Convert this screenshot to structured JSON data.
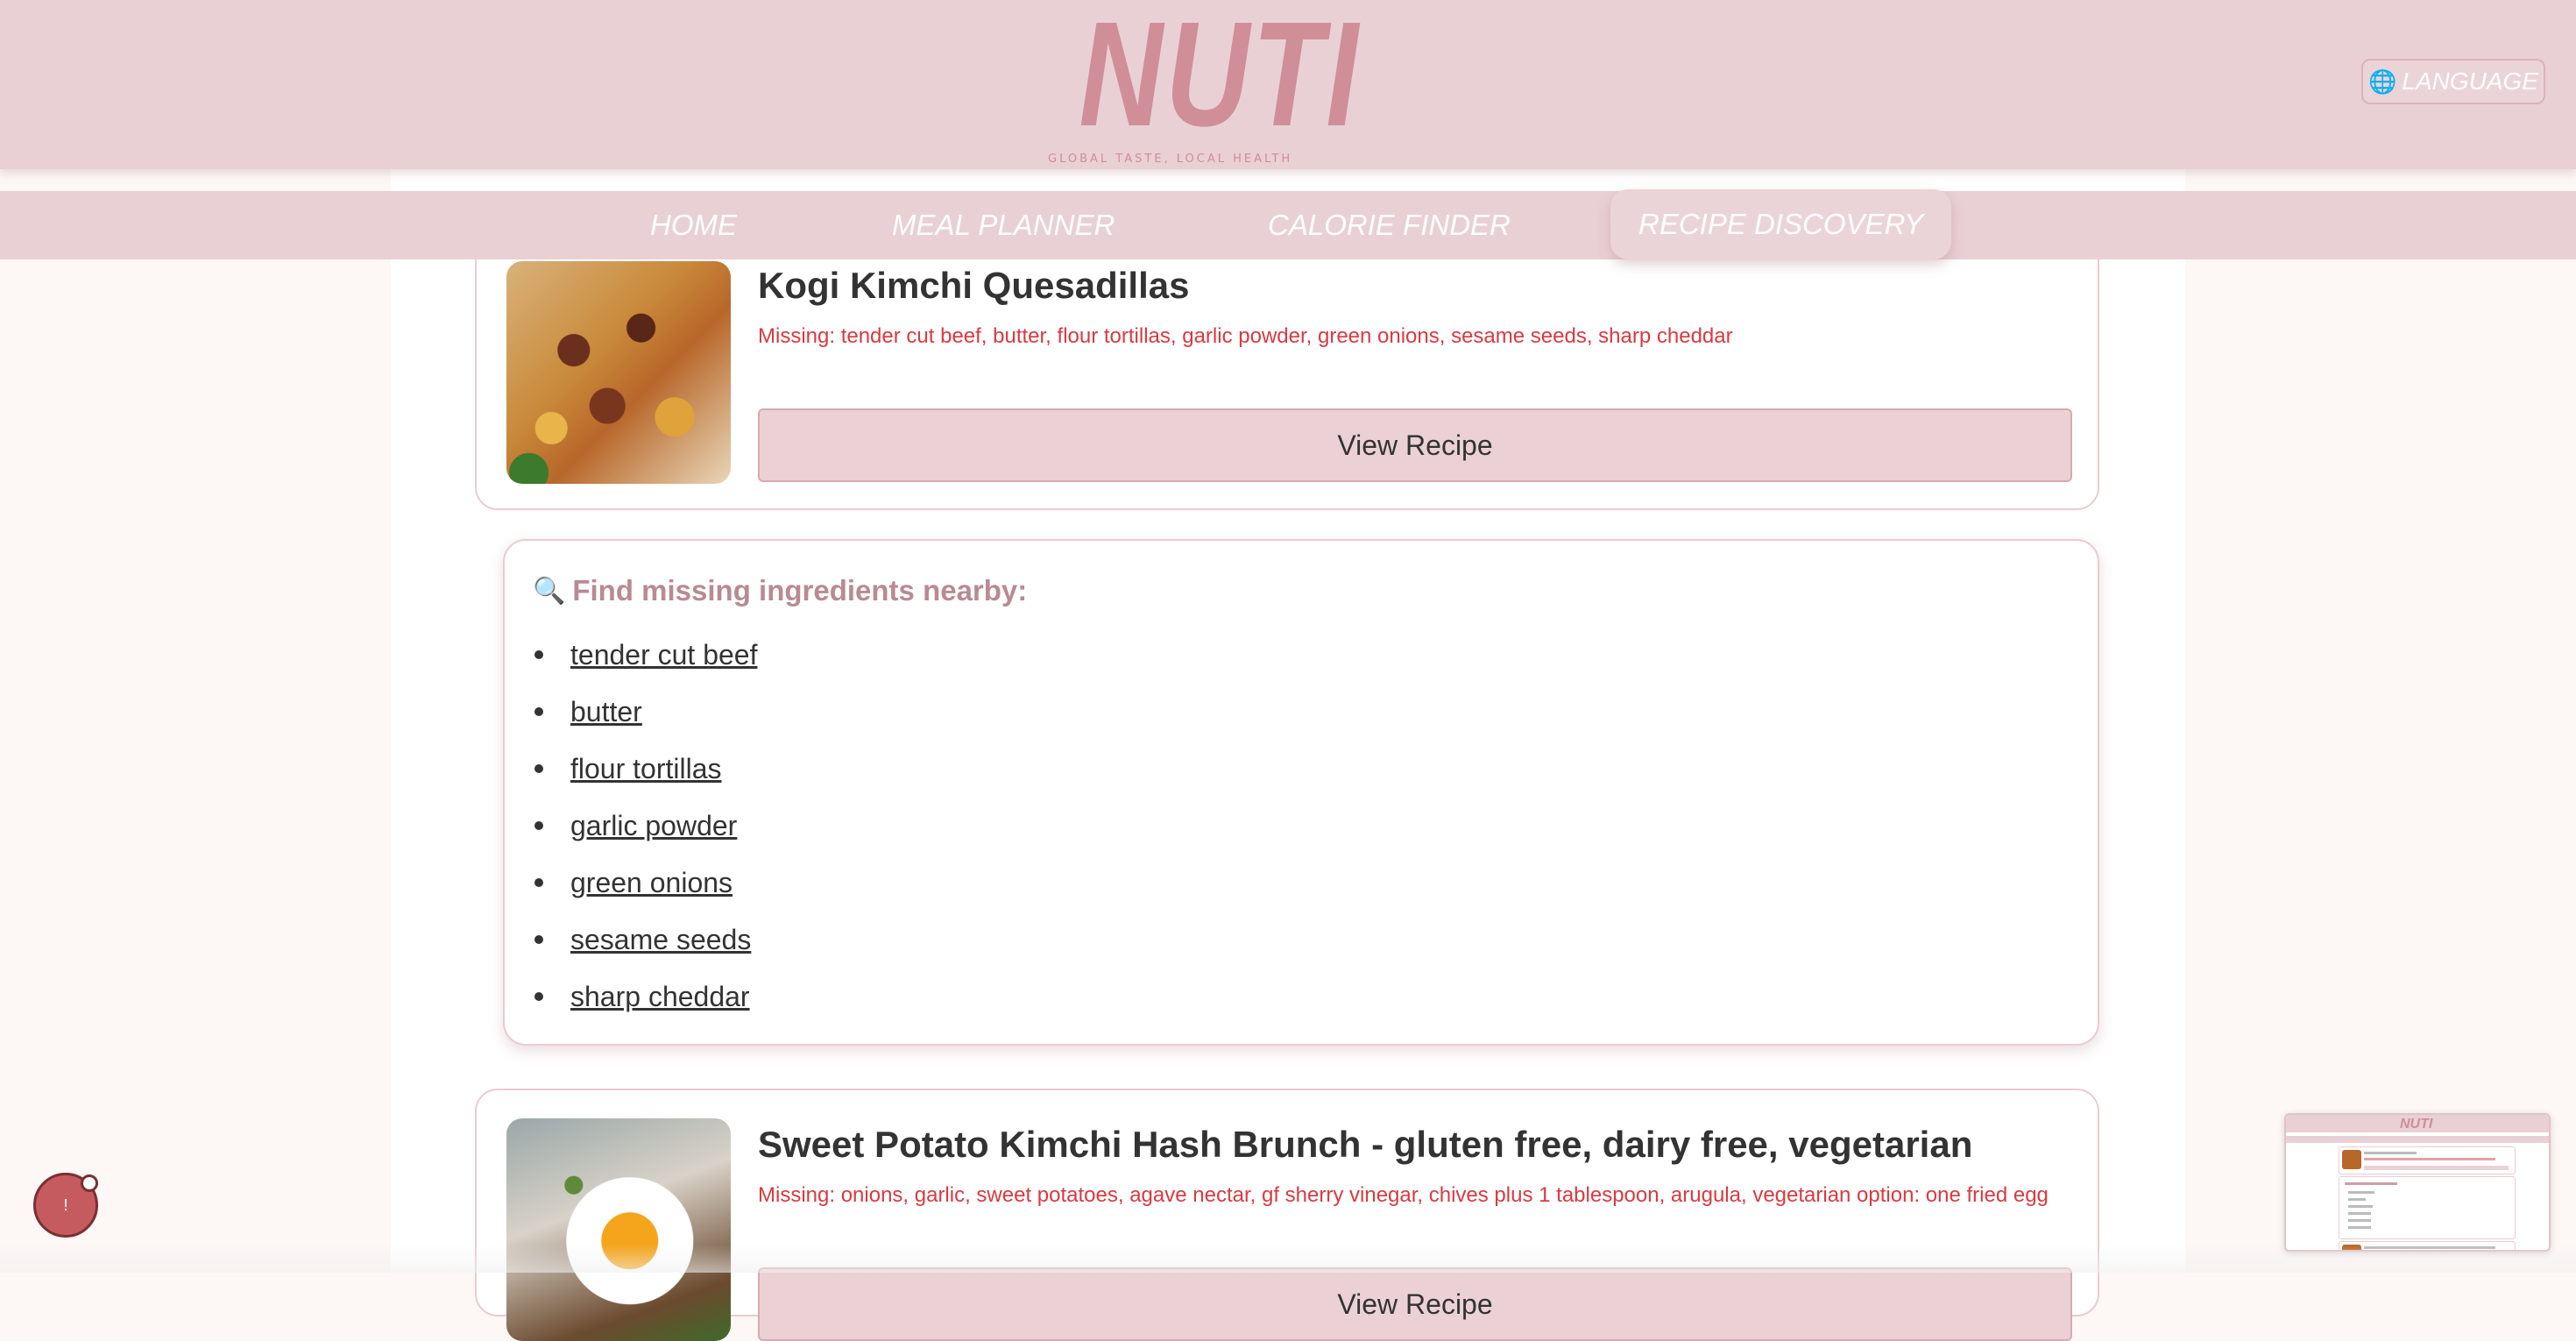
{
  "header": {
    "logo_text": "NUTI",
    "tagline": "GLOBAL TASTE, LOCAL HEALTH",
    "language_button": "LANGUAGE",
    "language_icon": "globe-icon"
  },
  "nav": {
    "items": [
      {
        "label": "HOME"
      },
      {
        "label": "MEAL PLANNER"
      },
      {
        "label": "CALORIE FINDER"
      },
      {
        "label": "RECIPE DISCOVERY",
        "active": true
      }
    ]
  },
  "recipes": [
    {
      "title": "Kogi Kimchi Quesadillas",
      "missing": "Missing: tender cut beef, butter, flour tortillas, garlic powder, green onions, sesame seeds, sharp cheddar",
      "button": "View Recipe"
    },
    {
      "title": "Sweet Potato Kimchi Hash Brunch - gluten free, dairy free, vegetarian",
      "missing": "Missing: onions, garlic, sweet potatoes, agave nectar, gf sherry vinegar, chives plus 1 tablespoon, arugula, vegetarian option: one fried egg",
      "button": "View Recipe"
    }
  ],
  "find_nearby": {
    "icon": "magnifier-icon",
    "heading": "Find missing ingredients nearby:",
    "ingredients": [
      "tender cut beef",
      "butter",
      "flour tortillas",
      "garlic powder",
      "green onions",
      "sesame seeds",
      "sharp cheddar"
    ]
  },
  "widget": {
    "label": "!"
  },
  "minimap": {
    "logo_text": "NUTI"
  },
  "colors": {
    "header_bg": "#e9d0d5",
    "accent_pink": "#cf8e98",
    "missing_red": "#d93a40",
    "page_bg": "#fdf7f5"
  }
}
